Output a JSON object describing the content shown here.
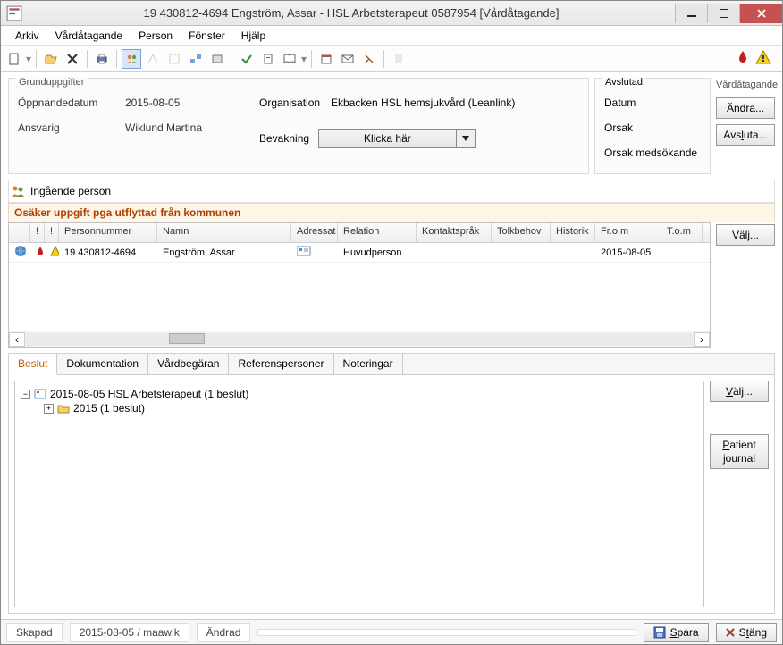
{
  "title": "19 430812-4694   Engström, Assar   -   HSL Arbetsterapeut   0587954   [Vårdåtagande]",
  "menu": [
    "Arkiv",
    "Vårdåtagande",
    "Person",
    "Fönster",
    "Hjälp"
  ],
  "grund": {
    "section_label": "Grunduppgifter",
    "oppnande_label": "Öppnandedatum",
    "oppnande_value": "2015-08-05",
    "ansvarig_label": "Ansvarig",
    "ansvarig_value": "Wiklund Martina",
    "organisation_label": "Organisation",
    "organisation_value": "Ekbacken HSL hemsjukvård (Leanlink)",
    "bevakning_label": "Bevakning",
    "bevakning_button": "Klicka här"
  },
  "avslutad": {
    "section_label": "Avslutad",
    "datum_label": "Datum",
    "orsak_label": "Orsak",
    "orsak_med_label": "Orsak medsökande"
  },
  "side": {
    "header": "Vårdåtagande",
    "andra": "Ändra...",
    "avsluta": "Avsluta..."
  },
  "ing": {
    "header": "Ingående person",
    "warning": "Osäker uppgift pga utflyttad från kommunen",
    "columns": {
      "ic1": "",
      "ic2": "!",
      "ic3": "!",
      "pn": "Personnummer",
      "namn": "Namn",
      "adr": "Adressat",
      "rel": "Relation",
      "spr": "Kontaktspråk",
      "tolk": "Tolkbehov",
      "hist": "Historik",
      "from": "Fr.o.m",
      "tom": "T.o.m"
    },
    "row": {
      "pn": "19 430812-4694",
      "namn": "Engström, Assar",
      "rel": "Huvudperson",
      "from": "2015-08-05"
    },
    "valj": "Välj..."
  },
  "tabs": [
    "Beslut",
    "Dokumentation",
    "Vårdbegäran",
    "Referenspersoner",
    "Noteringar"
  ],
  "tree": {
    "root": "2015-08-05  HSL Arbetsterapeut  (1 beslut)",
    "child": "2015   (1 beslut)",
    "valj": "Välj...",
    "patient1": "Patient",
    "patient2": "journal"
  },
  "status": {
    "skapad_label": "Skapad",
    "skapad_val": "2015-08-05 / maawik",
    "andrad_label": "Ändrad",
    "spara": "Spara",
    "stang": "Stäng"
  }
}
